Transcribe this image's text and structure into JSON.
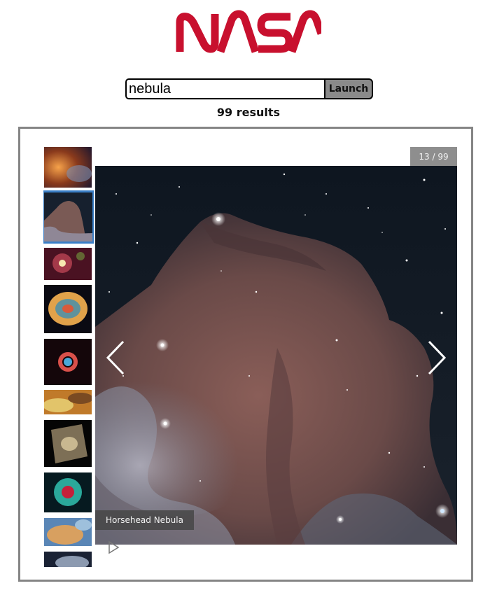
{
  "brand": {
    "name": "NASA",
    "color": "#c8102e"
  },
  "search": {
    "value": "nebula",
    "button_label": "Launch"
  },
  "results": {
    "count_text": "99 results"
  },
  "gallery": {
    "counter": "13 / 99",
    "caption": "Horsehead Nebula",
    "current_index": 13,
    "total": 99,
    "thumbnails": [
      {
        "icon": "nebula-thumbnail",
        "active": false
      },
      {
        "icon": "horsehead-nebula-thumbnail",
        "active": true
      },
      {
        "icon": "star-cluster-thumbnail",
        "active": false
      },
      {
        "icon": "crab-nebula-thumbnail",
        "active": false
      },
      {
        "icon": "ring-nebula-thumbnail",
        "active": false
      },
      {
        "icon": "gas-cloud-thumbnail",
        "active": false
      },
      {
        "icon": "planetary-nebula-thumbnail",
        "active": false
      },
      {
        "icon": "helix-nebula-thumbnail",
        "active": false
      },
      {
        "icon": "pillars-thumbnail",
        "active": false
      },
      {
        "icon": "dust-cloud-thumbnail",
        "active": false
      }
    ],
    "icons": {
      "prev": "chevron-left-icon",
      "next": "chevron-right-icon",
      "play": "play-icon"
    }
  }
}
